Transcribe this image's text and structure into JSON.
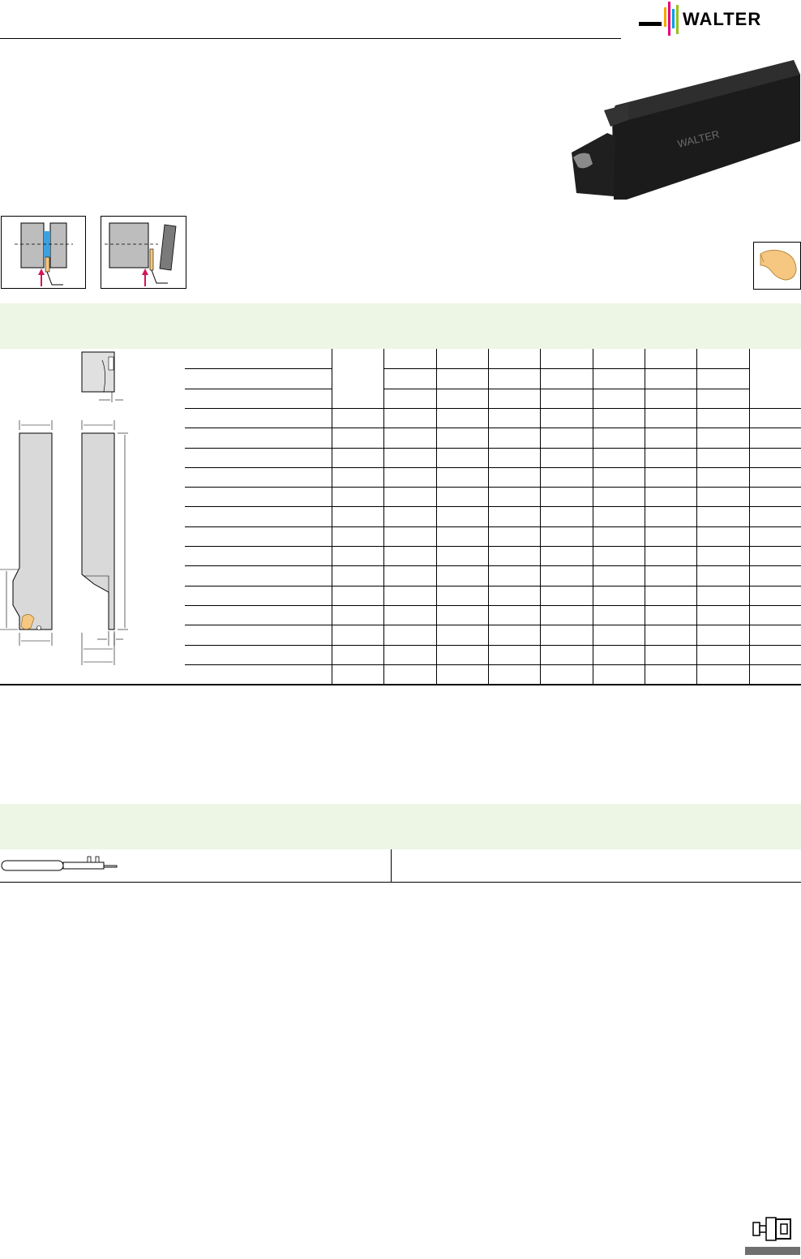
{
  "brand": {
    "name": "WALTER",
    "colors": [
      "#f7a600",
      "#e4007c",
      "#009ee0",
      "#95c11f"
    ]
  },
  "product_photo": {
    "engraving": "WALTER"
  },
  "icons": {
    "grooving_application": "grooving-diagram-icon",
    "parting_application": "parting-off-diagram-icon",
    "insert": "grooving-insert-icon",
    "key": "clamping-key-icon",
    "section_tab": "tool-holder-section-icon"
  },
  "colors": {
    "band": "#edf6e5",
    "insert": "#f5c780",
    "arrow": "#d4145a",
    "holder": "#d9d9d9",
    "tab": "#6f6f6f"
  },
  "spec_table": {
    "columns": 8,
    "header_rows": 3,
    "body_rows": 14
  }
}
